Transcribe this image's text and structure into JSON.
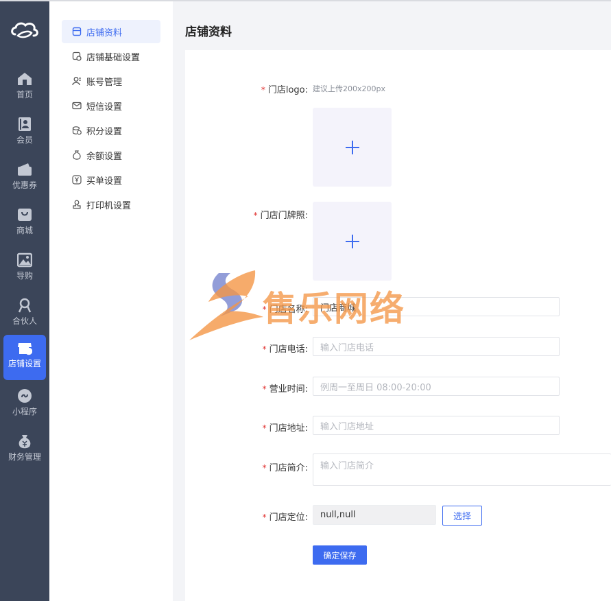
{
  "nav": {
    "items": [
      {
        "label": "首页",
        "icon": "home-icon"
      },
      {
        "label": "会员",
        "icon": "member-icon"
      },
      {
        "label": "优惠券",
        "icon": "coupon-icon"
      },
      {
        "label": "商城",
        "icon": "mall-icon"
      },
      {
        "label": "导购",
        "icon": "guide-icon"
      },
      {
        "label": "合伙人",
        "icon": "partner-icon"
      },
      {
        "label": "店铺设置",
        "icon": "store-settings-icon",
        "active": true
      },
      {
        "label": "小程序",
        "icon": "miniprogram-icon"
      },
      {
        "label": "财务管理",
        "icon": "finance-icon"
      }
    ]
  },
  "submenu": {
    "items": [
      {
        "label": "店铺资料",
        "icon": "store-icon",
        "active": true
      },
      {
        "label": "店铺基础设置",
        "icon": "store-settings-icon"
      },
      {
        "label": "账号管理",
        "icon": "account-icon"
      },
      {
        "label": "短信设置",
        "icon": "mail-icon"
      },
      {
        "label": "积分设置",
        "icon": "points-icon"
      },
      {
        "label": "余额设置",
        "icon": "balance-icon"
      },
      {
        "label": "买单设置",
        "icon": "yen-icon"
      },
      {
        "label": "打印机设置",
        "icon": "printer-icon"
      }
    ]
  },
  "page": {
    "title": "店铺资料"
  },
  "form": {
    "logo_label": "门店logo:",
    "logo_hint": "建议上传200x200px",
    "license_label": "门店门牌照:",
    "name_label": "门店名称:",
    "name_value": "门店商城",
    "phone_label": "门店电话:",
    "phone_placeholder": "输入门店电话",
    "hours_label": "营业时间:",
    "hours_placeholder": "例周一至周日 08:00-20:00",
    "address_label": "门店地址:",
    "address_placeholder": "输入门店地址",
    "intro_label": "门店简介:",
    "intro_placeholder": "输入门店简介",
    "location_label": "门店定位:",
    "location_value": "null,null",
    "select_button": "选择",
    "save_button": "确定保存",
    "required_mark": "*"
  },
  "watermark": {
    "text": "售乐网络"
  },
  "colors": {
    "sidebar_bg": "#3b4559",
    "accent": "#3d6bf0",
    "required": "#e0302e",
    "watermark": "#f49646"
  }
}
